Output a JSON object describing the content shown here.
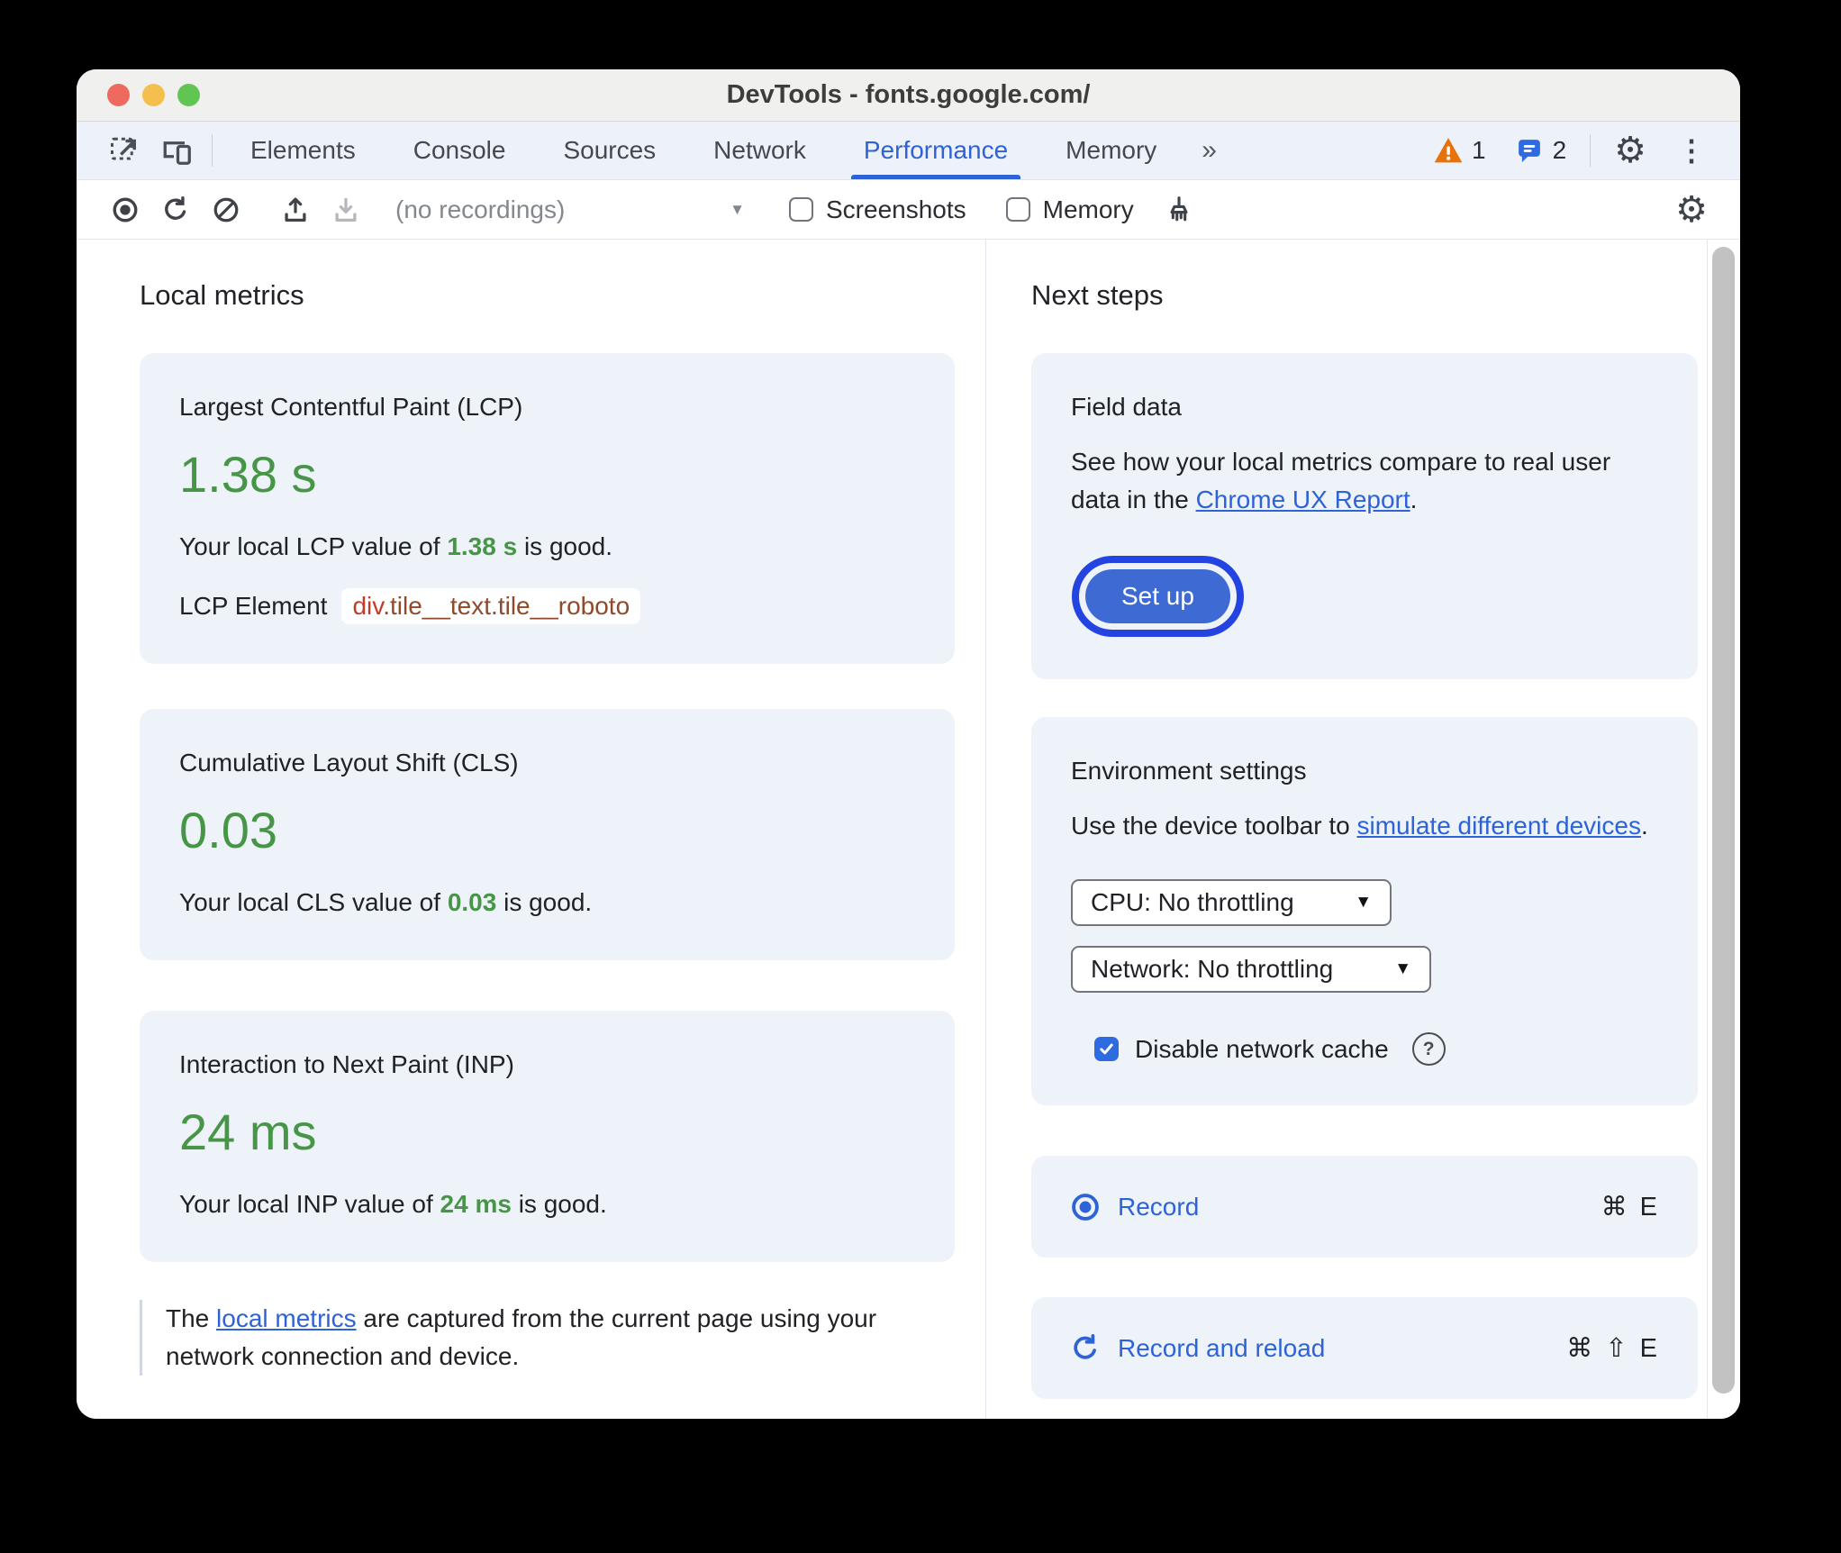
{
  "window": {
    "title": "DevTools - fonts.google.com/"
  },
  "tabs": {
    "items": [
      "Elements",
      "Console",
      "Sources",
      "Network",
      "Performance",
      "Memory"
    ],
    "active": "Performance",
    "warning_count": "1",
    "message_count": "2"
  },
  "toolbar": {
    "recordings_dropdown": "(no recordings)",
    "screenshots_label": "Screenshots",
    "memory_label": "Memory"
  },
  "local_metrics": {
    "heading": "Local metrics",
    "lcp": {
      "title": "Largest Contentful Paint (LCP)",
      "value": "1.38 s",
      "desc_prefix": "Your local LCP value of ",
      "desc_value": "1.38 s",
      "desc_suffix": " is good.",
      "element_label": "LCP Element",
      "element_tag": "div",
      "element_classes": ".tile__text.tile__roboto"
    },
    "cls": {
      "title": "Cumulative Layout Shift (CLS)",
      "value": "0.03",
      "desc_prefix": "Your local CLS value of ",
      "desc_value": "0.03",
      "desc_suffix": " is good."
    },
    "inp": {
      "title": "Interaction to Next Paint (INP)",
      "value": "24 ms",
      "desc_prefix": "Your local INP value of ",
      "desc_value": "24 ms",
      "desc_suffix": " is good."
    },
    "note_prefix": "The ",
    "note_link": "local metrics",
    "note_suffix": " are captured from the current page using your network connection and device."
  },
  "next_steps": {
    "heading": "Next steps",
    "field_data": {
      "title": "Field data",
      "body_prefix": "See how your local metrics compare to real user data in the ",
      "body_link": "Chrome UX Report",
      "body_suffix": ".",
      "button": "Set up"
    },
    "environment": {
      "title": "Environment settings",
      "body_prefix": "Use the device toolbar to ",
      "body_link": "simulate different devices",
      "body_suffix": ".",
      "cpu_select": "CPU: No throttling",
      "network_select": "Network: No throttling",
      "cache_label": "Disable network cache"
    },
    "record": {
      "label": "Record",
      "shortcut": "⌘ E"
    },
    "record_reload": {
      "label": "Record and reload",
      "shortcut": "⌘ ⇧ E"
    }
  },
  "icons": {
    "overflow_chevrons": "»",
    "gear": "⚙",
    "dots": "⋮",
    "dropdown_arrow": "▼",
    "help": "?"
  },
  "colors": {
    "accent_blue": "#2e63d8",
    "focus_ring_blue": "#2444e2",
    "button_blue": "#3e6bd3",
    "checkbox_blue": "#2f6be0",
    "good_green": "#479647",
    "warning_orange": "#e8710a",
    "card_background": "#eef2f9",
    "tabbar_background": "#edf1fa",
    "selector_tag_red": "#c53a29",
    "selector_class_brown": "#8f4a2b"
  }
}
